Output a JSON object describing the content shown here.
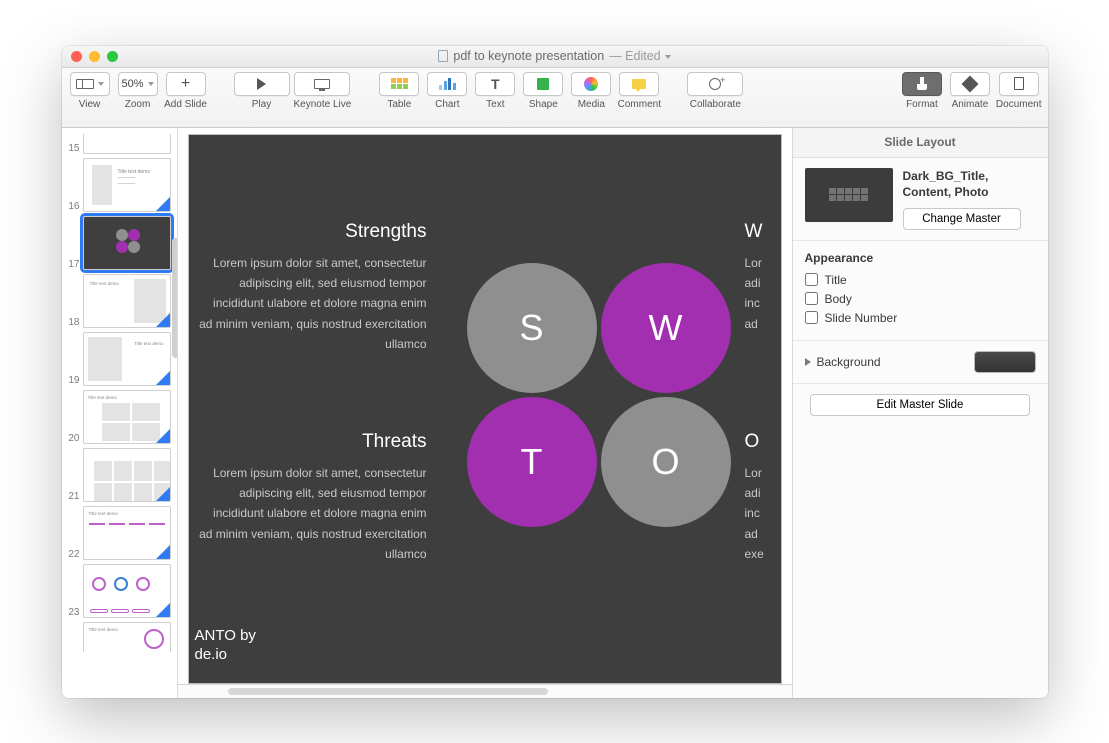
{
  "window": {
    "title": "pdf to keynote presentation",
    "status": "— Edited"
  },
  "toolbar": {
    "view": "View",
    "zoom": "Zoom",
    "zoom_value": "50%",
    "add_slide": "Add Slide",
    "play": "Play",
    "keynote_live": "Keynote Live",
    "table": "Table",
    "chart": "Chart",
    "text": "Text",
    "shape": "Shape",
    "media": "Media",
    "comment": "Comment",
    "collaborate": "Collaborate",
    "format": "Format",
    "animate": "Animate",
    "document": "Document"
  },
  "thumbs": {
    "numbers": [
      "15",
      "16",
      "17",
      "18",
      "19",
      "20",
      "21",
      "22",
      "23"
    ],
    "selected": "17"
  },
  "slide": {
    "strengths_title": "Strengths",
    "strengths_body": "Lorem ipsum dolor sit amet, consectetur adipiscing elit, sed eiusmod tempor incididunt ulabore et dolore magna enim ad minim veniam, quis nostrud exercitation ullamco",
    "threats_title": "Threats",
    "threats_body": "Lorem ipsum dolor sit amet, consectetur adipiscing elit, sed eiusmod tempor incididunt ulabore et dolore magna enim ad minim veniam, quis nostrud exercitation ullamco",
    "weak_title": "W",
    "weak_line1": "Lor",
    "weak_line2": "adi",
    "weak_line3": "inc",
    "weak_line4": "ad",
    "opp_title": "O",
    "opp_line1": "Lor",
    "opp_line2": "adi",
    "opp_line3": "inc",
    "opp_line4": "ad",
    "opp_line5": "exe",
    "circle_s": "S",
    "circle_w": "W",
    "circle_t": "T",
    "circle_o": "O",
    "footer_l1": "ANTO by",
    "footer_l2": "de.io"
  },
  "inspector": {
    "header": "Slide Layout",
    "layout_name": "Dark_BG_Title, Content, Photo",
    "change_master": "Change Master",
    "appearance": "Appearance",
    "chk_title": "Title",
    "chk_body": "Body",
    "chk_slide_no": "Slide Number",
    "background": "Background",
    "edit_master": "Edit Master Slide"
  }
}
